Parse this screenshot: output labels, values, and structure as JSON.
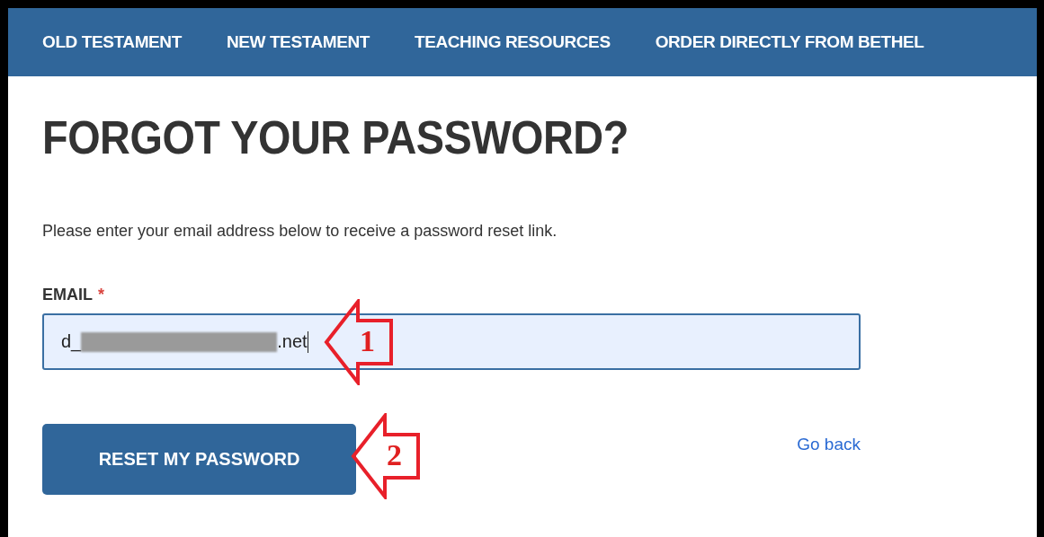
{
  "nav": {
    "items": [
      {
        "label": "OLD TESTAMENT"
      },
      {
        "label": "NEW TESTAMENT"
      },
      {
        "label": "TEACHING RESOURCES"
      },
      {
        "label": "ORDER DIRECTLY FROM BETHEL"
      }
    ]
  },
  "heading": "FORGOT YOUR PASSWORD?",
  "intro": "Please enter your email address below to receive a password reset link.",
  "email": {
    "label": "EMAIL",
    "required_mark": "*",
    "value_start": "d_",
    "value_end": ".net",
    "redacted": true
  },
  "submit": {
    "label": "RESET MY PASSWORD"
  },
  "back_link": "Go back",
  "annotations": [
    {
      "label": "1"
    },
    {
      "label": "2"
    }
  ]
}
